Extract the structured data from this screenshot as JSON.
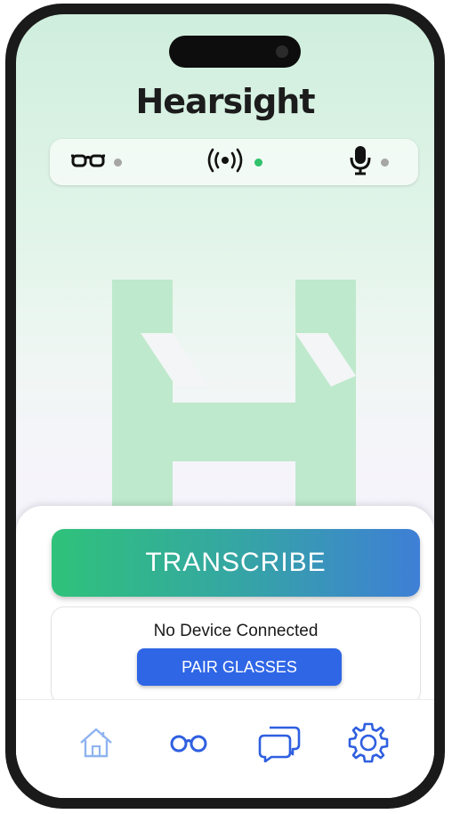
{
  "app": {
    "logo_text": "Hearsight"
  },
  "status_bar": {
    "items": [
      {
        "icon": "glasses-icon",
        "status": "disconnected",
        "dot_color": "#a6a6a6"
      },
      {
        "icon": "broadcast-icon",
        "status": "connected",
        "dot_color": "#2fc26b"
      },
      {
        "icon": "microphone-icon",
        "status": "disconnected",
        "dot_color": "#a6a6a6"
      }
    ]
  },
  "main": {
    "transcribe_label": "TRANSCRIBE",
    "device_status": "No Device Connected",
    "pair_label": "PAIR GLASSES"
  },
  "nav": {
    "items": [
      {
        "icon": "home-icon"
      },
      {
        "icon": "glasses-icon"
      },
      {
        "icon": "chat-icon"
      },
      {
        "icon": "settings-icon",
        "active": true
      }
    ]
  },
  "colors": {
    "brand_green": "#2fc27a",
    "brand_blue": "#2f66e6",
    "watermark_green": "#bfe9cc",
    "nav_icon_blue": "#2f5fe0"
  }
}
